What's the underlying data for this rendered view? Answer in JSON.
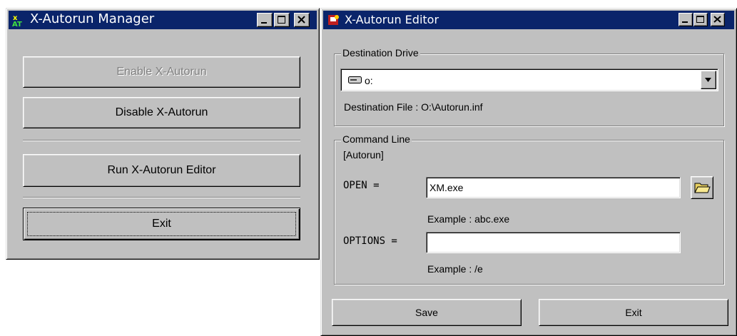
{
  "manager": {
    "title": "X-Autorun Manager",
    "enable_label": "Enable X-Autorun",
    "disable_label": "Disable X-Autorun",
    "run_editor_label": "Run X-Autorun Editor",
    "exit_label": "Exit"
  },
  "editor": {
    "title": "X-Autorun Editor",
    "destination_group": "Destination Drive",
    "drive_value": "o:",
    "destination_file": "Destination File : O:\\Autorun.inf",
    "command_group": "Command Line",
    "section": "[Autorun]",
    "open_label": "OPEN =",
    "open_value": "XM.exe",
    "open_example": "Example : abc.exe",
    "options_label": "OPTIONS =",
    "options_value": "",
    "options_example": "Example : /e",
    "save_label": "Save",
    "exit_label": "Exit"
  },
  "colors": {
    "titlebar": "#0a246a",
    "face": "#c0c0c0"
  },
  "icons": {
    "manager_app": "app-icon",
    "editor_app": "app-icon",
    "drive": "drive-icon",
    "browse": "folder-icon",
    "minimize": "minimize-icon",
    "maximize": "maximize-icon",
    "close": "close-icon",
    "dropdown": "chevron-down-icon"
  }
}
